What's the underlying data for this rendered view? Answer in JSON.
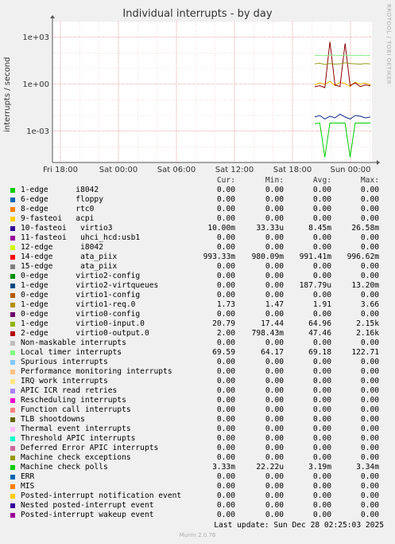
{
  "chart_data": {
    "type": "line",
    "title": "Individual interrupts - by day",
    "ylabel": "interrupts / second",
    "yscale": "log",
    "ylim": [
      1e-05,
      10000
    ],
    "yticks": [
      {
        "label": "1e+03",
        "value": 1000
      },
      {
        "label": "1e+00",
        "value": 1
      },
      {
        "label": "1e-03",
        "value": 0.001
      }
    ],
    "xticks": [
      "Fri 18:00",
      "Sat 00:00",
      "Sat 06:00",
      "Sat 12:00",
      "Sat 18:00",
      "Sun 00:00"
    ],
    "grid": true,
    "series": [
      {
        "name": "14-edge ata_piix",
        "color": "#f2b300",
        "values": [
          0.9,
          1.2,
          1.0,
          1.5,
          0.8,
          1.3,
          1.1,
          0.7,
          1.4,
          1.0,
          1.2,
          0.9
        ]
      },
      {
        "name": "2-edge virtio0-output.0",
        "color": "#8a0000",
        "values": [
          0.7,
          0.8,
          0.6,
          500,
          0.9,
          0.7,
          400,
          0.8,
          1.2,
          0.7,
          0.9,
          0.8
        ]
      },
      {
        "name": "1-edge virtio0-input.0",
        "color": "#9a9a1a",
        "values": [
          20,
          22,
          18,
          21,
          19,
          20,
          23,
          21,
          20,
          19,
          21,
          20
        ]
      },
      {
        "name": "Non-maskable interrupts",
        "color": "#33cc33",
        "values": [
          1e-06,
          1e-06,
          1e-06,
          1e-06,
          1e-06,
          1e-06,
          1e-06,
          1e-06,
          1e-06,
          1e-06,
          1e-06,
          1e-06
        ]
      },
      {
        "name": "Local timer interrupts",
        "color": "#88ee88",
        "values": [
          70,
          68,
          69,
          72,
          70,
          69,
          70,
          71,
          69,
          70,
          68,
          70
        ]
      },
      {
        "name": "1-edge virtio2-virtqueues",
        "color": "#0a2a8a",
        "values": [
          0.008,
          0.01,
          0.006,
          0.009,
          0.007,
          0.012,
          0.008,
          0.006,
          0.01,
          0.009,
          0.007,
          0.008
        ]
      },
      {
        "name": "Machine check polls",
        "color": "#00cc00",
        "values": [
          0.003,
          0.0033,
          2.2e-05,
          0.0033,
          0.0033,
          0.0033,
          0.0033,
          2.2e-05,
          0.0033,
          0.0033,
          0.0033,
          0.0033
        ]
      }
    ]
  },
  "side_text": "RRDTOOL / TOBI OETIKER",
  "legend": {
    "headers": {
      "cur": "Cur:",
      "min": "Min:",
      "avg": "Avg:",
      "max": "Max:"
    },
    "rows": [
      {
        "name": "1-edge      i8042",
        "color": "#00cc00",
        "cur": "0.00",
        "min": "0.00",
        "avg": "0.00",
        "max": "0.00"
      },
      {
        "name": "6-edge      floppy",
        "color": "#0066b3",
        "cur": "0.00",
        "min": "0.00",
        "avg": "0.00",
        "max": "0.00"
      },
      {
        "name": "8-edge      rtc0",
        "color": "#ff8000",
        "cur": "0.00",
        "min": "0.00",
        "avg": "0.00",
        "max": "0.00"
      },
      {
        "name": "9-fasteoi   acpi",
        "color": "#ffcc00",
        "cur": "0.00",
        "min": "0.00",
        "avg": "0.00",
        "max": "0.00"
      },
      {
        "name": "10-fasteoi   virtio3",
        "color": "#330099",
        "cur": "10.00m",
        "min": "33.33u",
        "avg": "8.45m",
        "max": "26.58m"
      },
      {
        "name": "11-fasteoi   uhci_hcd:usb1",
        "color": "#990099",
        "cur": "0.00",
        "min": "0.00",
        "avg": "0.00",
        "max": "0.00"
      },
      {
        "name": "12-edge      i8042",
        "color": "#ccff00",
        "cur": "0.00",
        "min": "0.00",
        "avg": "0.00",
        "max": "0.00"
      },
      {
        "name": "14-edge      ata_piix",
        "color": "#ff0000",
        "cur": "993.33m",
        "min": "980.09m",
        "avg": "991.41m",
        "max": "996.62m"
      },
      {
        "name": "15-edge      ata_piix",
        "color": "#808080",
        "cur": "0.00",
        "min": "0.00",
        "avg": "0.00",
        "max": "0.00"
      },
      {
        "name": "0-edge      virtio2-config",
        "color": "#008f00",
        "cur": "0.00",
        "min": "0.00",
        "avg": "0.00",
        "max": "0.00"
      },
      {
        "name": "1-edge      virtio2-virtqueues",
        "color": "#00487d",
        "cur": "0.00",
        "min": "0.00",
        "avg": "187.79u",
        "max": "13.20m"
      },
      {
        "name": "0-edge      virtio1-config",
        "color": "#b35a00",
        "cur": "0.00",
        "min": "0.00",
        "avg": "0.00",
        "max": "0.00"
      },
      {
        "name": "1-edge      virtio1-req.0",
        "color": "#b38f00",
        "cur": "1.73",
        "min": "1.47",
        "avg": "1.91",
        "max": "3.66"
      },
      {
        "name": "0-edge      virtio0-config",
        "color": "#6b006b",
        "cur": "0.00",
        "min": "0.00",
        "avg": "0.00",
        "max": "0.00"
      },
      {
        "name": "1-edge      virtio0-input.0",
        "color": "#8fb300",
        "cur": "20.79",
        "min": "17.44",
        "avg": "64.96",
        "max": "2.15k"
      },
      {
        "name": "2-edge      virtio0-output.0",
        "color": "#b30000",
        "cur": "2.00",
        "min": "798.43m",
        "avg": "47.46",
        "max": "2.16k"
      },
      {
        "name": "Non-maskable interrupts",
        "color": "#bebebe",
        "cur": "0.00",
        "min": "0.00",
        "avg": "0.00",
        "max": "0.00"
      },
      {
        "name": "Local timer interrupts",
        "color": "#80ff80",
        "cur": "69.59",
        "min": "64.17",
        "avg": "69.18",
        "max": "122.71"
      },
      {
        "name": "Spurious interrupts",
        "color": "#80c9ff",
        "cur": "0.00",
        "min": "0.00",
        "avg": "0.00",
        "max": "0.00"
      },
      {
        "name": "Performance monitoring interrupts",
        "color": "#ffc080",
        "cur": "0.00",
        "min": "0.00",
        "avg": "0.00",
        "max": "0.00"
      },
      {
        "name": "IRQ work interrupts",
        "color": "#ffe680",
        "cur": "0.00",
        "min": "0.00",
        "avg": "0.00",
        "max": "0.00"
      },
      {
        "name": "APIC ICR read retries",
        "color": "#aa80ff",
        "cur": "0.00",
        "min": "0.00",
        "avg": "0.00",
        "max": "0.00"
      },
      {
        "name": "Rescheduling interrupts",
        "color": "#ee00cc",
        "cur": "0.00",
        "min": "0.00",
        "avg": "0.00",
        "max": "0.00"
      },
      {
        "name": "Function call interrupts",
        "color": "#ff8080",
        "cur": "0.00",
        "min": "0.00",
        "avg": "0.00",
        "max": "0.00"
      },
      {
        "name": "TLB shootdowns",
        "color": "#666600",
        "cur": "0.00",
        "min": "0.00",
        "avg": "0.00",
        "max": "0.00"
      },
      {
        "name": "Thermal event interrupts",
        "color": "#ffbfff",
        "cur": "0.00",
        "min": "0.00",
        "avg": "0.00",
        "max": "0.00"
      },
      {
        "name": "Threshold APIC interrupts",
        "color": "#00ffcc",
        "cur": "0.00",
        "min": "0.00",
        "avg": "0.00",
        "max": "0.00"
      },
      {
        "name": "Deferred Error APIC interrupts",
        "color": "#cc6699",
        "cur": "0.00",
        "min": "0.00",
        "avg": "0.00",
        "max": "0.00"
      },
      {
        "name": "Machine check exceptions",
        "color": "#999900",
        "cur": "0.00",
        "min": "0.00",
        "avg": "0.00",
        "max": "0.00"
      },
      {
        "name": "Machine check polls",
        "color": "#00cc00",
        "cur": "3.33m",
        "min": "22.22u",
        "avg": "3.19m",
        "max": "3.34m"
      },
      {
        "name": "ERR",
        "color": "#0066b3",
        "cur": "0.00",
        "min": "0.00",
        "avg": "0.00",
        "max": "0.00"
      },
      {
        "name": "MIS",
        "color": "#ff8000",
        "cur": "0.00",
        "min": "0.00",
        "avg": "0.00",
        "max": "0.00"
      },
      {
        "name": "Posted-interrupt notification event",
        "color": "#ffcc00",
        "cur": "0.00",
        "min": "0.00",
        "avg": "0.00",
        "max": "0.00"
      },
      {
        "name": "Nested posted-interrupt event",
        "color": "#330099",
        "cur": "0.00",
        "min": "0.00",
        "avg": "0.00",
        "max": "0.00"
      },
      {
        "name": "Posted-interrupt wakeup event",
        "color": "#990099",
        "cur": "0.00",
        "min": "0.00",
        "avg": "0.00",
        "max": "0.00"
      }
    ]
  },
  "last_update": "Last update: Sun Dec 28 02:25:03 2025",
  "munin_version": "Munin 2.0.76"
}
